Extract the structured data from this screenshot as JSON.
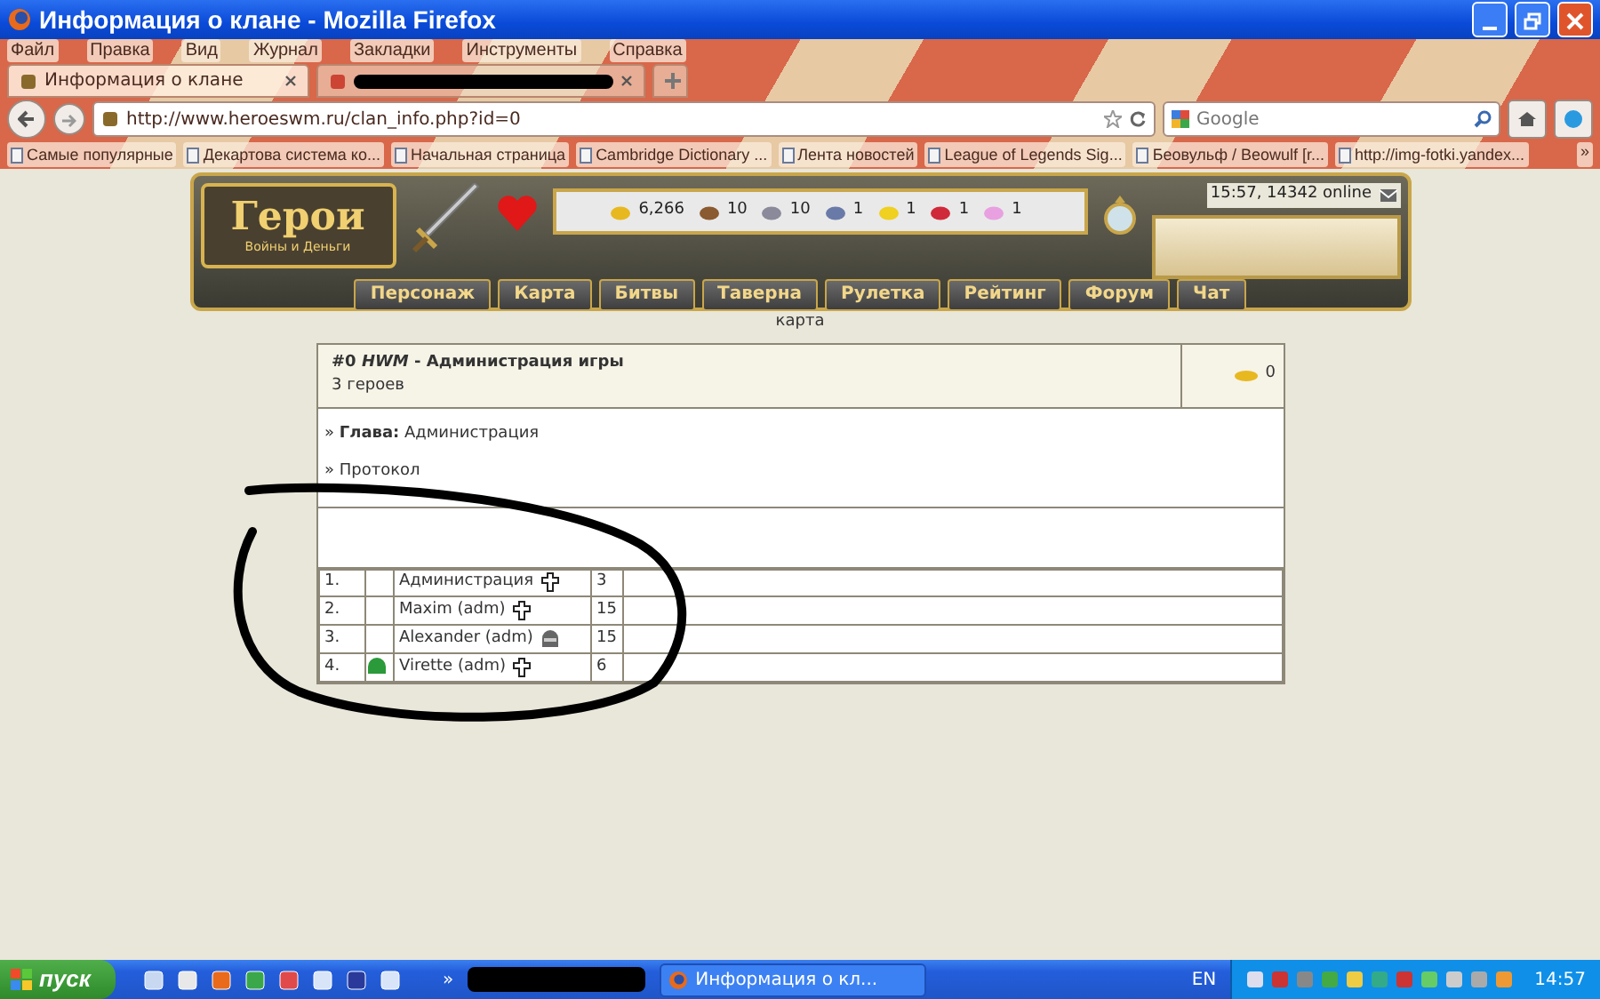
{
  "window": {
    "title": "Информация о клане - Mozilla Firefox"
  },
  "menu": [
    "Файл",
    "Правка",
    "Вид",
    "Журнал",
    "Закладки",
    "Инструменты",
    "Справка"
  ],
  "tabs": [
    {
      "label": "Информация о клане",
      "selected": true
    },
    {
      "selected": false
    }
  ],
  "address": {
    "url": "http://www.heroeswm.ru/clan_info.php?id=0"
  },
  "search": {
    "placeholder": "Google"
  },
  "bookmarks": [
    "Самые популярные",
    "Декартова система ко...",
    "Начальная страница",
    "Cambridge Dictionary ...",
    "Лента новостей",
    "League of Legends Sig...",
    "Беовульф / Beowulf [r...",
    "http://img-fotki.yandex..."
  ],
  "bookmarks_more": "»",
  "game_header": {
    "logo_title": "Герои",
    "logo_subtitle": "Войны и Деньги",
    "clock": "15:57, 14342 online",
    "resources": [
      {
        "kind": "gold",
        "value": "6,266"
      },
      {
        "kind": "wood",
        "value": "10"
      },
      {
        "kind": "ore",
        "value": "10"
      },
      {
        "kind": "mercury",
        "value": "1"
      },
      {
        "kind": "sulfur",
        "value": "1"
      },
      {
        "kind": "crystal",
        "value": "1"
      },
      {
        "kind": "gems",
        "value": "1"
      }
    ],
    "nav": [
      "Персонаж",
      "Карта",
      "Битвы",
      "Таверна",
      "Рулетка",
      "Рейтинг",
      "Форум",
      "Чат"
    ],
    "map_label": "карта"
  },
  "clan": {
    "title": "#0 *HWM* - Администрация игры",
    "subtitle": "3 героев",
    "gold": "0",
    "info": [
      "» **Глава:** Администрация",
      "» Протокол"
    ],
    "members": [
      {
        "number": "1.",
        "badge": false,
        "name": "Администрация",
        "kind": "cross",
        "level": "3"
      },
      {
        "number": "2.",
        "badge": false,
        "name": "Maxim (adm)",
        "kind": "cross",
        "level": "15"
      },
      {
        "number": "3.",
        "badge": false,
        "name": "Alexander (adm)",
        "kind": "helmet",
        "level": "15"
      },
      {
        "number": "4.",
        "badge": true,
        "name": "Virette (adm)",
        "kind": "cross",
        "level": "6"
      }
    ]
  },
  "taskbar": {
    "start": "пуск",
    "quick_launch_more": "»",
    "tasks": [
      {
        "label": "Информация о кл..."
      }
    ],
    "language": "EN",
    "clock": "14:57"
  }
}
